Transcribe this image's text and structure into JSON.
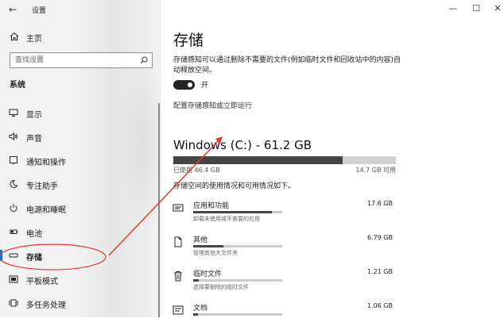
{
  "window": {
    "app_title": "设置",
    "controls": {
      "minimize": "—",
      "maximize": "☐",
      "close": "✕"
    }
  },
  "sidebar": {
    "back_icon": "←",
    "home_label": "主页",
    "search_placeholder": "查找设置",
    "section_title": "系统",
    "items": [
      {
        "label": "显示",
        "icon": "display-icon"
      },
      {
        "label": "声音",
        "icon": "speaker-icon"
      },
      {
        "label": "通知和操作",
        "icon": "notification-icon"
      },
      {
        "label": "专注助手",
        "icon": "moon-icon"
      },
      {
        "label": "电源和睡眠",
        "icon": "power-icon"
      },
      {
        "label": "电池",
        "icon": "battery-icon"
      },
      {
        "label": "存储",
        "icon": "storage-icon",
        "active": true
      },
      {
        "label": "平板模式",
        "icon": "tablet-icon"
      },
      {
        "label": "多任务处理",
        "icon": "multitask-icon"
      }
    ]
  },
  "main": {
    "page_title": "存储",
    "description": "存储感知可以通过删除不需要的文件(例如临时文件和回收站中的内容)自动释放空间。",
    "toggle": {
      "state": "on",
      "label": "开"
    },
    "config_link": "配置存储感知或立即运行",
    "drive": {
      "title": "Windows (C:) - 61.2 GB",
      "used_text": "已使用 46.4 GB",
      "free_text": "14.7 GB 可用",
      "used_fraction": 0.76
    },
    "usage_desc": "存储空间的使用情况和可用情况如下。",
    "categories": [
      {
        "name": "应用和功能",
        "size": "17.6 GB",
        "sub": "卸载未使用或不需要的应用",
        "fraction": 0.88,
        "icon": "apps-icon"
      },
      {
        "name": "其他",
        "size": "6.79 GB",
        "sub": "管理其他大文件夹",
        "fraction": 0.34,
        "icon": "other-files-icon"
      },
      {
        "name": "临时文件",
        "size": "1.21 GB",
        "sub": "选择要删除的临时文件",
        "fraction": 0.06,
        "icon": "trash-icon"
      },
      {
        "name": "文档",
        "size": "1.06 GB",
        "sub": "",
        "fraction": 0.05,
        "icon": "document-icon"
      }
    ]
  },
  "colors": {
    "accent": "#0078d7",
    "annotation": "#e53935"
  }
}
